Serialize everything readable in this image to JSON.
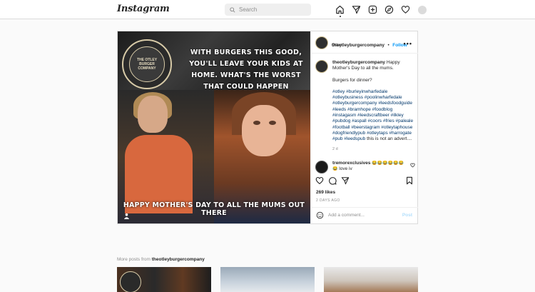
{
  "app": {
    "logo": "Instagram"
  },
  "search": {
    "placeholder": "Search"
  },
  "nav": {
    "icons": [
      "home-icon",
      "direct-icon",
      "new-post-icon",
      "explore-icon",
      "heart-icon",
      "profile-avatar"
    ]
  },
  "post": {
    "image": {
      "headline": "WITH BURGERS THIS GOOD, YOU'LL LEAVE YOUR KIDS AT HOME. WHAT'S THE WORST THAT COULD HAPPEN",
      "caption_overlay": "HAPPY MOTHER'S DAY TO ALL THE MUMS OUT THERE",
      "badge_text": "THE OTLEY BURGER COMPANY"
    },
    "header": {
      "username": "theotleyburgercompany",
      "separator": "•",
      "follow": "Follow",
      "location": "Otley",
      "more": "•••"
    },
    "caption": {
      "username": "theotleyburgercompany",
      "text1": "Happy Mother's Day to all the mums.",
      "text2": "Burgers for dinner?",
      "hashtags": "#otley #burleyinwharfedale #otleybusiness #poolinwharfedale #otleyburgercompany #leedsfoodguide #leeds #bramhope #foodblog #instagasm #leedscraftbeer #ilkley #pubdog #aspall #coors #fries #paleale #football #beerstagram #otleytaphouse #dogfriendlypub #otleytaps #harrogate #pub #leedspub",
      "tail": " this is not an advert....",
      "time": "2 d"
    },
    "comment": {
      "username": "tremorexclusives",
      "emojis": "😂😂😂😂😂😂😂",
      "text": " love iv"
    },
    "likes": "269 likes",
    "ago": "2 DAYS AGO",
    "add_comment": {
      "placeholder": "Add a comment...",
      "post": "Post"
    }
  },
  "more": {
    "label": "More posts from ",
    "username": "theotleyburgercompany"
  }
}
